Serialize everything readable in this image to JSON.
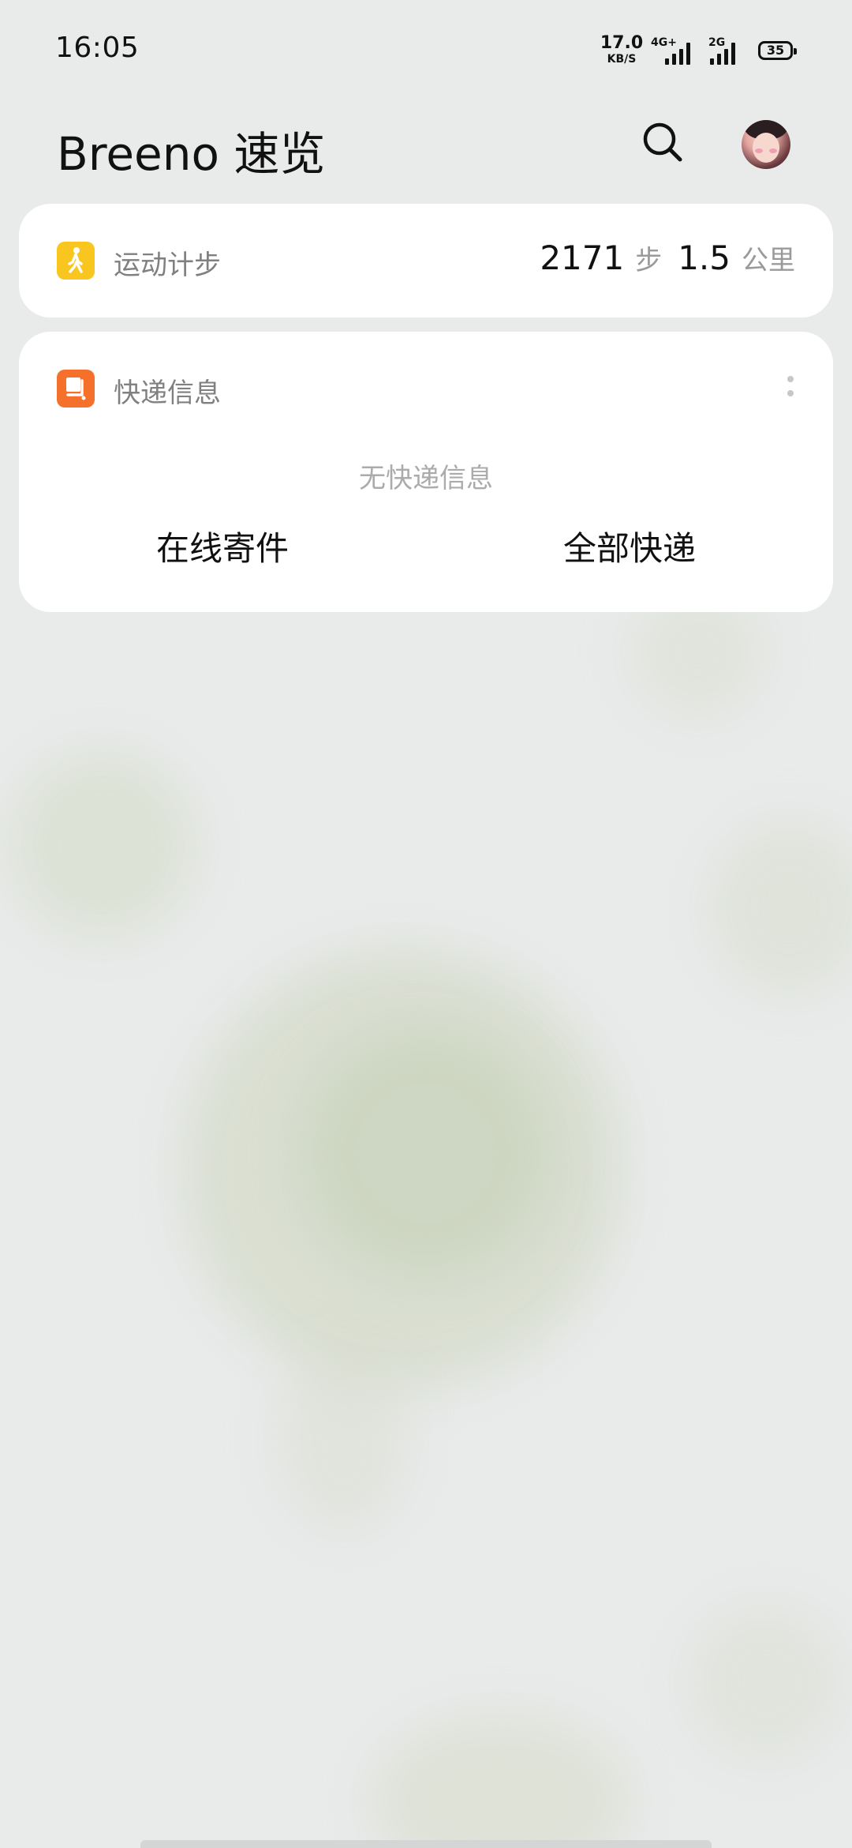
{
  "status_bar": {
    "time": "16:05",
    "net_speed_value": "17.0",
    "net_speed_unit": "KB/S",
    "signal_1_label": "4G+",
    "signal_2_label": "2G",
    "battery_level": "35"
  },
  "header": {
    "title": "Breeno 速览",
    "search_icon": "search-icon",
    "avatar": "avatar"
  },
  "step_card": {
    "icon": "walking-icon",
    "label": "运动计步",
    "steps": "2171",
    "steps_unit": "步",
    "distance": "1.5",
    "distance_unit": "公里"
  },
  "express_card": {
    "icon": "package-icon",
    "label": "快递信息",
    "more_icon": "more-vertical-icon",
    "empty_text": "无快递信息",
    "actions": [
      {
        "label": "在线寄件"
      },
      {
        "label": "全部快递"
      }
    ]
  },
  "colors": {
    "background": "#e9ebeb",
    "card": "#ffffff",
    "step_accent": "#f9c61f",
    "express_accent": "#f5702a",
    "label_gray": "#808080",
    "empty_gray": "#ababab"
  }
}
